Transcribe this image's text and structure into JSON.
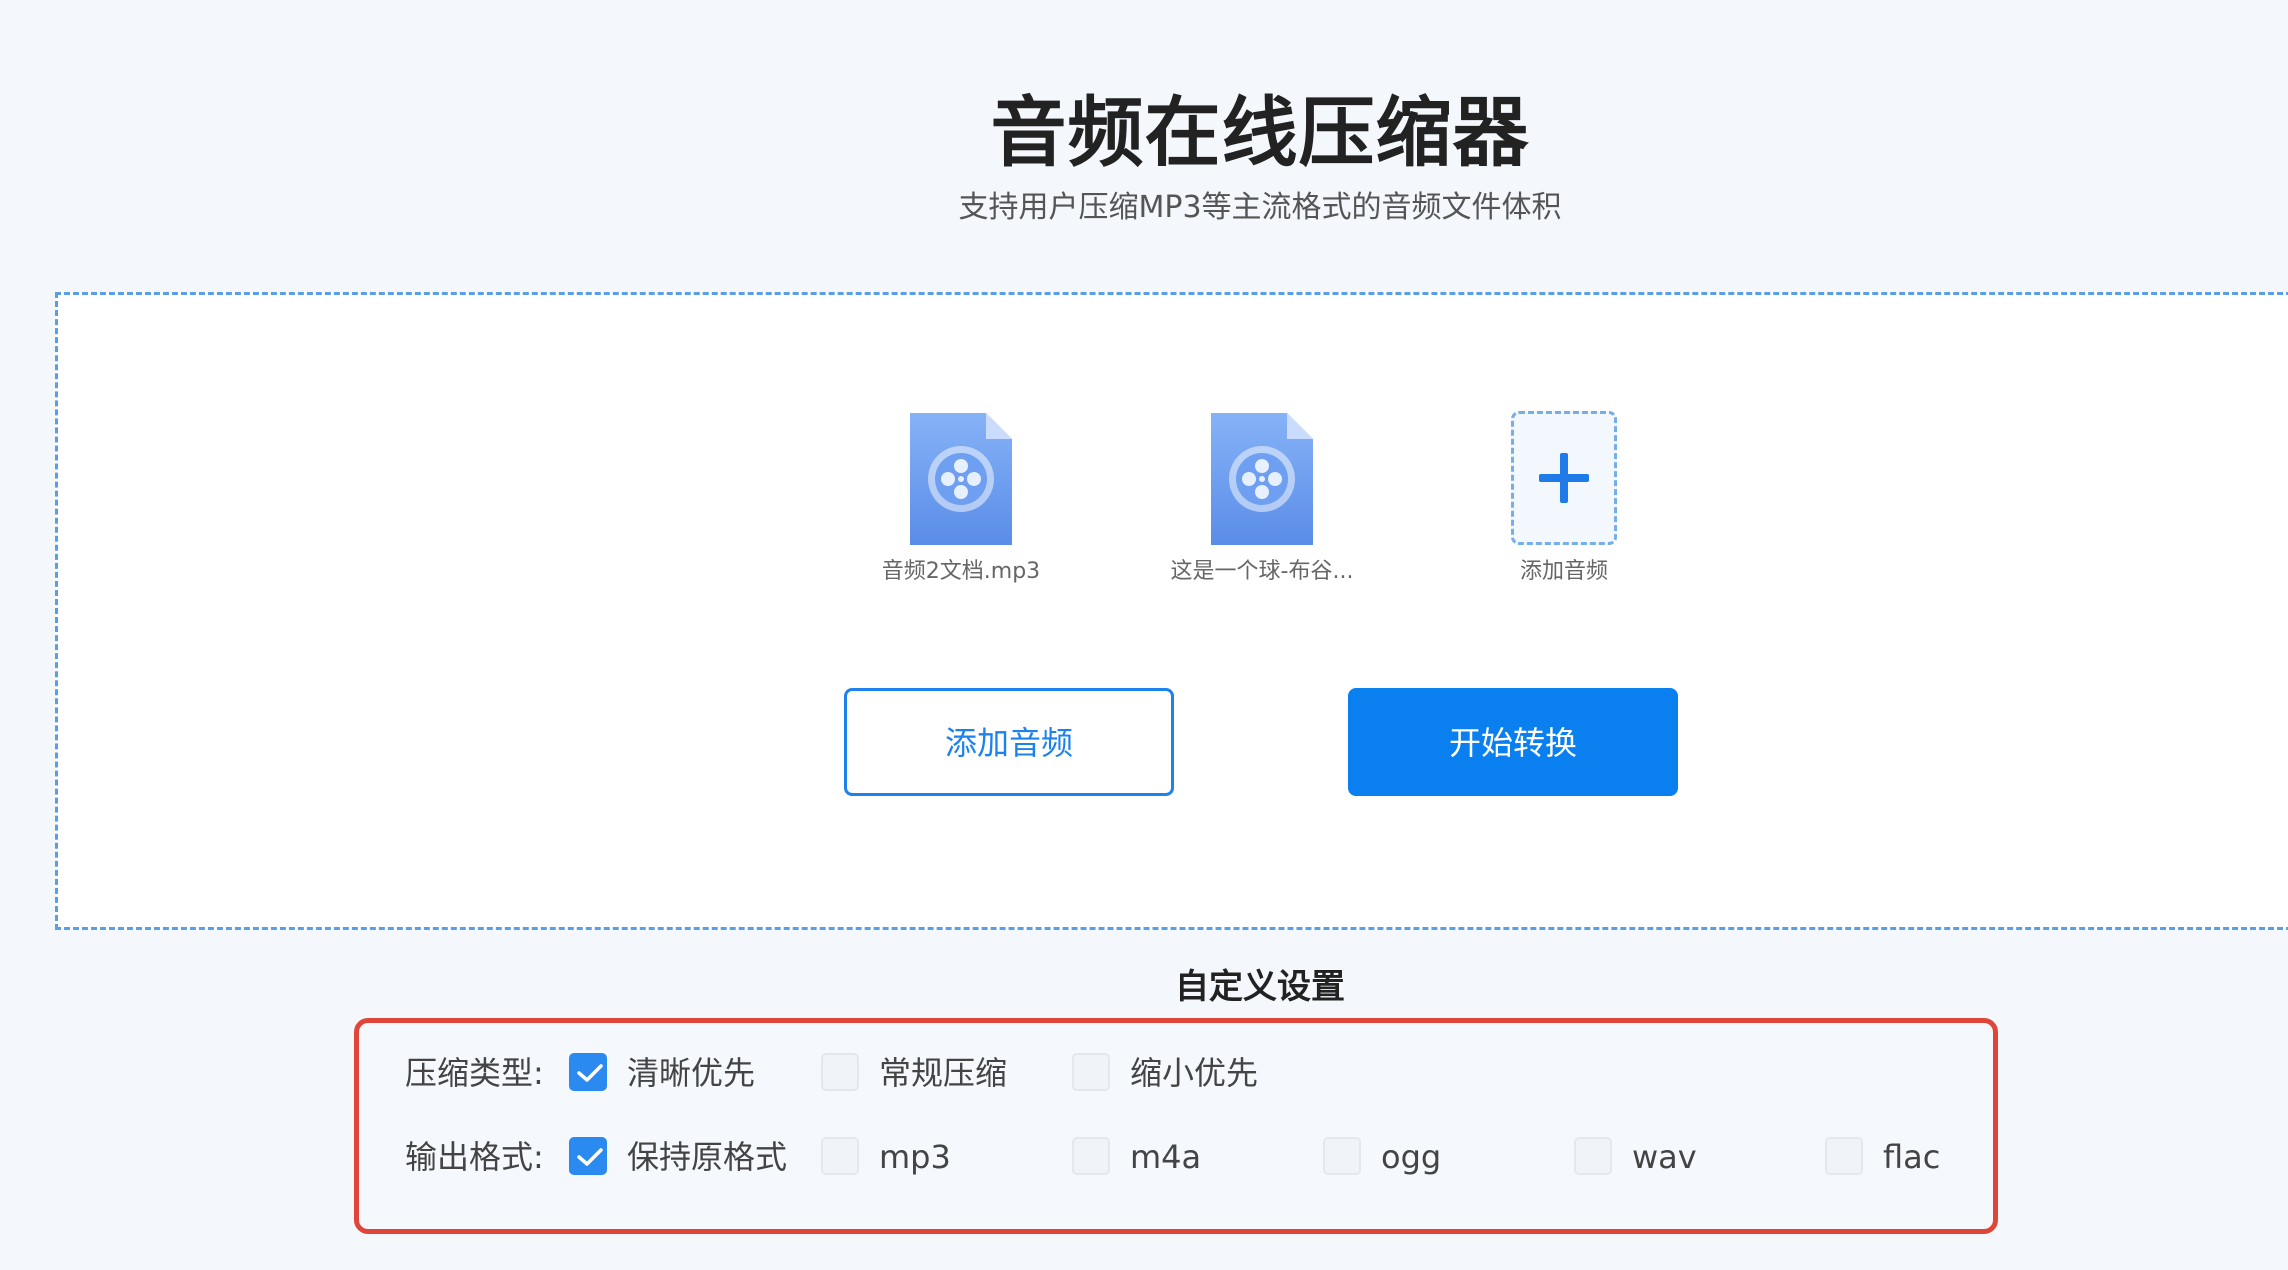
{
  "header": {
    "title": "音频在线压缩器",
    "subtitle": "支持用户压缩MP3等主流格式的音频文件体积"
  },
  "files": [
    {
      "name": "音频2文档.mp3",
      "icon": "audio-file-icon"
    },
    {
      "name": "这是一个球-布谷...",
      "icon": "audio-file-icon"
    }
  ],
  "add_tile": {
    "label": "添加音频",
    "icon": "plus-icon"
  },
  "buttons": {
    "add_audio": "添加音频",
    "start_convert": "开始转换"
  },
  "settings": {
    "title": "自定义设置",
    "compression_type": {
      "label": "压缩类型:",
      "options": [
        {
          "label": "清晰优先",
          "checked": true
        },
        {
          "label": "常规压缩",
          "checked": false
        },
        {
          "label": "缩小优先",
          "checked": false
        }
      ]
    },
    "output_format": {
      "label": "输出格式:",
      "options": [
        {
          "label": "保持原格式",
          "checked": true
        },
        {
          "label": "mp3",
          "checked": false
        },
        {
          "label": "m4a",
          "checked": false
        },
        {
          "label": "ogg",
          "checked": false
        },
        {
          "label": "wav",
          "checked": false
        },
        {
          "label": "flac",
          "checked": false
        }
      ]
    }
  },
  "colors": {
    "accent": "#0a7ff0",
    "highlight_border": "#e0453a",
    "file_icon": "#6e9ff0"
  }
}
